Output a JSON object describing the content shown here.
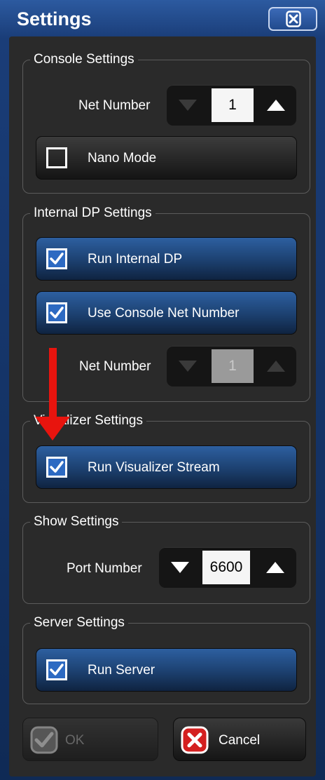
{
  "window": {
    "title": "Settings"
  },
  "console": {
    "legend": "Console Settings",
    "net_number_label": "Net Number",
    "net_number_value": "1",
    "nano_mode_label": "Nano Mode",
    "nano_mode_checked": false
  },
  "internal_dp": {
    "legend": "Internal DP Settings",
    "run_label": "Run Internal DP",
    "run_checked": true,
    "use_console_label": "Use Console Net Number",
    "use_console_checked": true,
    "net_number_label": "Net Number",
    "net_number_value": "1"
  },
  "visualizer": {
    "legend": "Visualizer Settings",
    "run_label": "Run Visualizer Stream",
    "run_checked": true
  },
  "show": {
    "legend": "Show Settings",
    "port_label": "Port Number",
    "port_value": "6600"
  },
  "server": {
    "legend": "Server Settings",
    "run_label": "Run Server",
    "run_checked": true
  },
  "buttons": {
    "ok": "OK",
    "cancel": "Cancel"
  },
  "colors": {
    "title_bar": "#2c5aa0",
    "panel": "#2a2a2a",
    "active_toggle": "#2d5fa0",
    "annotation_arrow": "#e8140e",
    "cancel_icon": "#d42020"
  },
  "icons": {
    "close": "close-x-icon",
    "up": "triangle-up-icon",
    "down": "triangle-down-icon",
    "check": "checkmark-icon",
    "ok": "checkmark-circle-icon",
    "cancel": "x-square-icon"
  }
}
